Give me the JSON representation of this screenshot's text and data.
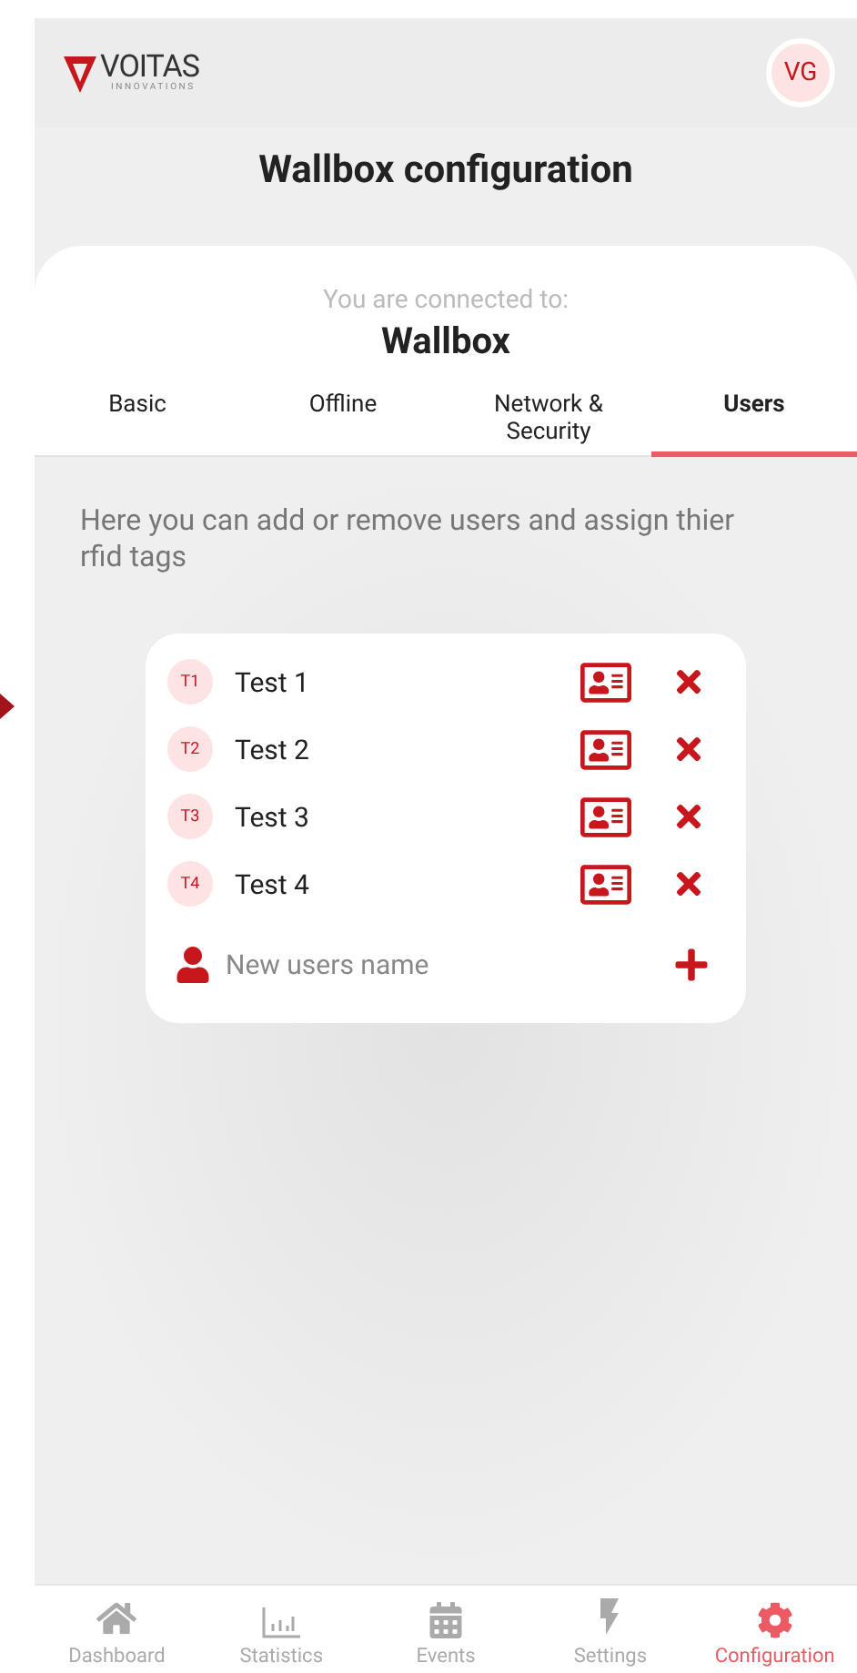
{
  "header": {
    "logo_text": "VOITAS",
    "logo_subtext": "INNOVATIONS",
    "avatar": "VG"
  },
  "title": "Wallbox configuration",
  "connection": {
    "label": "You are connected to:",
    "device": "Wallbox"
  },
  "tabs": [
    {
      "label": "Basic",
      "selected": false
    },
    {
      "label": "Offline",
      "selected": false
    },
    {
      "label": "Network & Security",
      "selected": false
    },
    {
      "label": "Users",
      "selected": true
    }
  ],
  "description": "Here you can add or remove users and assign thier rfid tags",
  "users": [
    {
      "badge": "T1",
      "name": "Test 1"
    },
    {
      "badge": "T2",
      "name": "Test 2"
    },
    {
      "badge": "T3",
      "name": "Test 3"
    },
    {
      "badge": "T4",
      "name": "Test 4"
    }
  ],
  "new_user": {
    "placeholder": "New users name"
  },
  "nav": [
    {
      "label": "Dashboard",
      "kind": "home",
      "selected": false
    },
    {
      "label": "Statistics",
      "kind": "chart",
      "selected": false
    },
    {
      "label": "Events",
      "kind": "calendar",
      "selected": false
    },
    {
      "label": "Settings",
      "kind": "bolt",
      "selected": false
    },
    {
      "label": "Configuration",
      "kind": "gear",
      "selected": true
    }
  ]
}
